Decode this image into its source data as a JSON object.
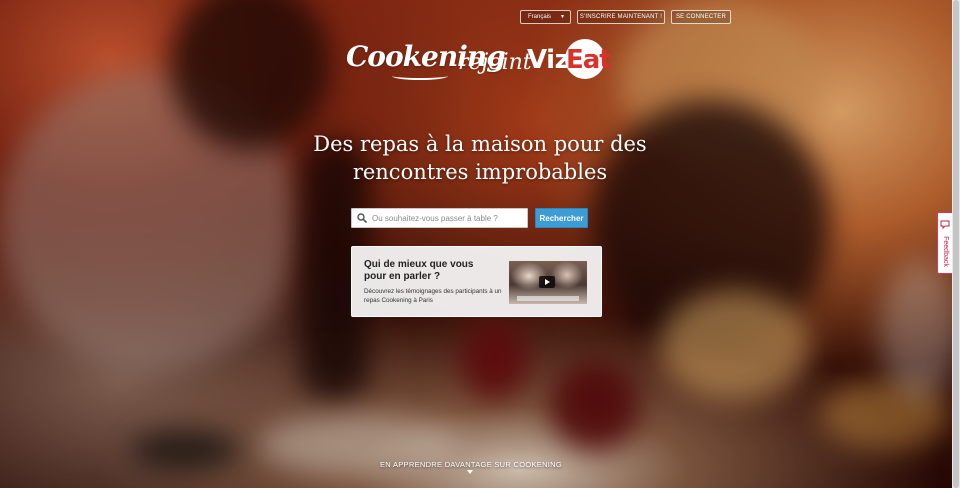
{
  "header": {
    "language_select": "Français",
    "signup_label": "S'INSCRIRE MAINTENANT !",
    "login_label": "SE CONNECTER"
  },
  "logo": {
    "brand": "Cookening",
    "joins": "rejoint",
    "partner_prefix": "Viz",
    "partner_suffix": "Eat"
  },
  "hero": {
    "headline_line1": "Des repas à la maison pour des",
    "headline_line2": "rencontres improbables"
  },
  "search": {
    "placeholder": "Ou souhaitez-vous passer à table ?",
    "button_label": "Rechercher"
  },
  "testimonial": {
    "title": "Qui de mieux que vous pour en parler ?",
    "description": "Découvrez les témoignages des participants à un repas Cookening à Paris"
  },
  "footer": {
    "learn_more": "EN APPRENDRE DAVANTAGE SUR COOKENING"
  },
  "feedback": {
    "label": "Feedback"
  },
  "icons": {
    "search": "search-icon",
    "play": "play-icon",
    "feedback": "feedback-icon",
    "dropdown": "chevron-down-icon",
    "learn_more_arrow": "chevron-down-icon"
  },
  "colors": {
    "search_button": "#3d9bd6",
    "vizeat_red": "#d9322b",
    "feedback_accent": "#e0325d"
  }
}
